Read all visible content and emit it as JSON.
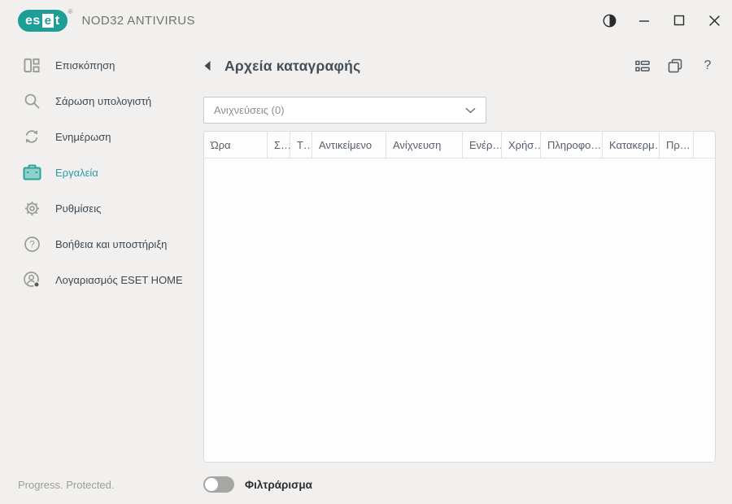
{
  "window": {
    "logo": {
      "part_es": "es",
      "part_e": "e",
      "part_t": "t",
      "registered": "®"
    },
    "product_name": "NOD32 ANTIVIRUS"
  },
  "sidebar": {
    "items": [
      {
        "label": "Επισκόπηση",
        "icon": "overview-dashboard-icon",
        "active": false
      },
      {
        "label": "Σάρωση υπολογιστή",
        "icon": "computer-scan-search-icon",
        "active": false
      },
      {
        "label": "Ενημέρωση",
        "icon": "update-refresh-icon",
        "active": false
      },
      {
        "label": "Εργαλεία",
        "icon": "tools-toolbox-icon",
        "active": true
      },
      {
        "label": "Ρυθμίσεις",
        "icon": "settings-gear-icon",
        "active": false
      },
      {
        "label": "Βοήθεια και υποστήριξη",
        "icon": "help-support-icon",
        "active": false
      },
      {
        "label": "Λογαριασμός ESET HOME",
        "icon": "eset-home-account-icon",
        "active": false
      }
    ]
  },
  "footer": {
    "tagline": "Progress. Protected."
  },
  "main": {
    "title": "Αρχεία καταγραφής",
    "dropdown": {
      "value": "Ανιχνεύσεις (0)"
    },
    "table": {
      "columns": [
        "Ώρα",
        "Σ…",
        "Τ…",
        "Αντικείμενο",
        "Ανίχνευση",
        "Ενέρ…",
        "Χρήσ…",
        "Πληροφο…",
        "Κατακερμ…",
        "Πρ…",
        ""
      ],
      "rows": []
    },
    "filter": {
      "label": "Φιλτράρισμα",
      "state": "off"
    }
  },
  "colors": {
    "accent": "#1d9e96",
    "active_link": "#2b9aa6",
    "background": "#f1f0ee",
    "panel": "#fdfdfd"
  }
}
